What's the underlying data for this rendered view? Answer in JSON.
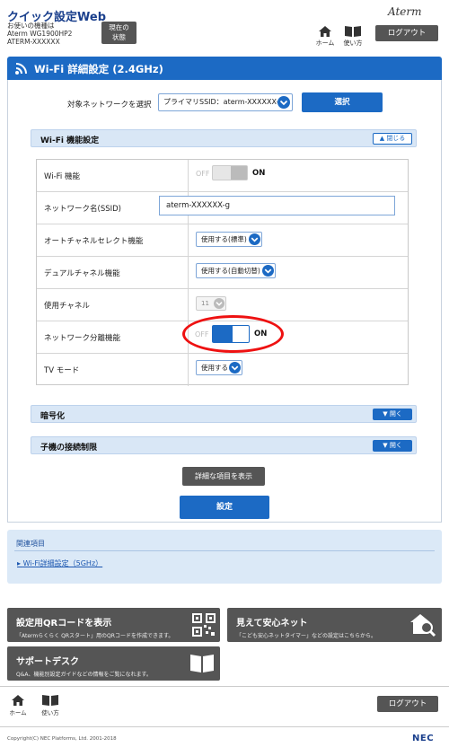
{
  "header": {
    "app_title": "クイック設定Web",
    "model_info": "お使いの機種は\nAterm WG1900HP2\nATERM-XXXXXX",
    "status_button": "現在の\n状態",
    "brand": "Aterm",
    "home_label": "ホーム",
    "help_label": "使い方",
    "logout_label": "ログアウト"
  },
  "section": {
    "title": "Wi-Fi 詳細設定 (2.4GHz)"
  },
  "target_network": {
    "label": "対象ネットワークを選択",
    "selected": "プライマリSSID：aterm-XXXXXX-g",
    "select_button": "選択"
  },
  "wifi_settings": {
    "title": "Wi-Fi 機能設定",
    "collapse_label": "閉じる",
    "rows": [
      {
        "label": "Wi-Fi 機能",
        "off_text": "OFF",
        "on_text": "ON"
      },
      {
        "label": "ネットワーク名(SSID)",
        "value": "aterm-XXXXXX-g"
      },
      {
        "label": "オートチャネルセレクト機能",
        "value": "使用する(標準)"
      },
      {
        "label": "デュアルチャネル機能",
        "value": "使用する(自動切替)"
      },
      {
        "label": "使用チャネル",
        "value": "11"
      },
      {
        "label": "ネットワーク分離機能",
        "off_text": "OFF",
        "on_text": "ON"
      },
      {
        "label": "TV モード",
        "value": "使用する"
      }
    ]
  },
  "encryption": {
    "title": "暗号化",
    "open_label": "開く"
  },
  "client_limit": {
    "title": "子機の接続制限",
    "open_label": "開く"
  },
  "buttons": {
    "show_details": "詳細な項目を表示",
    "apply": "設定"
  },
  "related": {
    "title": "関連項目",
    "link": "Wi-Fi詳細設定（5GHz）"
  },
  "cards": [
    {
      "title": "設定用QRコードを表示",
      "desc": "「Atermらくらく QRスタート」用のQRコードを作成できます。"
    },
    {
      "title": "見えて安心ネット",
      "desc": "「こども安心ネットタイマー」などの設定はこちらから。"
    },
    {
      "title": "サポートデスク",
      "desc": "Q&A、機能別設定ガイドなどの情報をご覧になれます。"
    }
  ],
  "footer": {
    "home_label": "ホーム",
    "help_label": "使い方",
    "logout_label": "ログアウト",
    "copyright": "Copyright(C) NEC Platforms, Ltd. 2001-2018",
    "nec": "NEC"
  },
  "colors": {
    "accent": "#1c6ac4",
    "highlight": "#ee1111",
    "dark_button": "#555555"
  }
}
